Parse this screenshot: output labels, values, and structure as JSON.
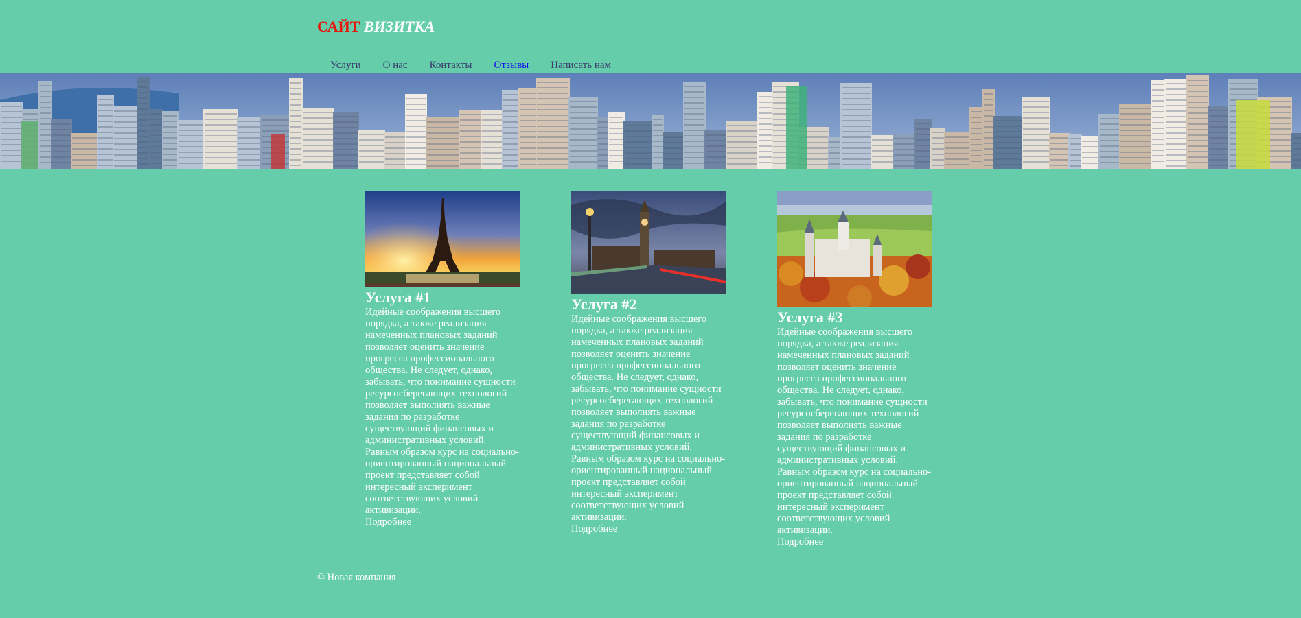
{
  "header": {
    "logo_part1": "САЙТ",
    "logo_part2": "ВИЗИТКА"
  },
  "nav": {
    "items": [
      "Услуги",
      "О нас",
      "Контакты",
      "Отзывы",
      "Написать нам"
    ],
    "active": "Отзывы"
  },
  "banner": {
    "subject": "city-skyline"
  },
  "cards": [
    {
      "image_subject": "eiffel-tower-sunset",
      "title": "Услуга #1",
      "text": "Идейные соображения высшего порядка, а также реализация намеченных плановых заданий позволяет оценить значение прогресса профессионального общества. Не следует, однако, забывать, что понимание сущности ресурсосберегающих технологий позволяет выполнять важные задания по разработке существующий финансовых и административных условий. Равным образом курс на социально-ориентированный национальный проект представляет собой интересный эксперимент соответствующих условий активизации.",
      "more": "Подробнее"
    },
    {
      "image_subject": "big-ben-bridge-dusk",
      "title": "Услуга #2",
      "text": "Идейные соображения высшего порядка, а также реализация намеченных плановых заданий позволяет оценить значение прогресса профессионального общества. Не следует, однако, забывать, что понимание сущности ресурсосберегающих технологий позволяет выполнять важные задания по разработке существующий финансовых и административных условий. Равным образом курс на социально-ориентированный национальный проект представляет собой интересный эксперимент соответствующих условий активизации.",
      "more": "Подробнее"
    },
    {
      "image_subject": "neuschwanstein-castle-autumn",
      "title": "Услуга #3",
      "text": "Идейные соображения высшего порядка, а также реализация намеченных плановых заданий позволяет оценить значение прогресса профессионального общества. Не следует, однако, забывать, что понимание сущности ресурсосберегающих технологий позволяет выполнять важные задания по разработке существующий финансовых и административных условий. Равным образом курс на социально-ориентированный национальный проект представляет собой интересный эксперимент соответствующих условий активизации.",
      "more": "Подробнее"
    }
  ],
  "footer": {
    "text": "© Новая компания"
  },
  "colors": {
    "background": "#66cdaa",
    "logo_accent": "#e8150c",
    "nav_text": "#3a3a6e",
    "nav_active": "#1010ee",
    "body_text": "#ffffff"
  }
}
